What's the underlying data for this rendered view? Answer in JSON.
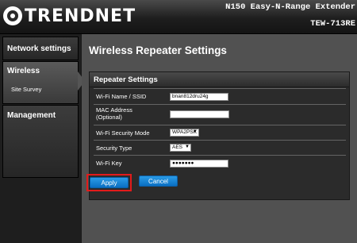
{
  "header": {
    "brand": "TRENDNET",
    "product_title": "N150 Easy-N-Range Extender",
    "model": "TEW-713RE"
  },
  "sidebar": {
    "items": [
      {
        "label": "Network settings"
      },
      {
        "label": "Wireless",
        "sub": "Site Survey"
      },
      {
        "label": "Management"
      }
    ]
  },
  "main": {
    "title": "Wireless Repeater Settings",
    "panel_title": "Repeater Settings",
    "fields": {
      "ssid_label": "Wi-Fi Name / SSID",
      "ssid_value": "bnan812dru24g",
      "mac_label_line1": "MAC Address",
      "mac_label_line2": "(Optional)",
      "mac_value": "",
      "security_mode_label": "Wi-Fi Security Mode",
      "security_mode_value": "WPA2PSK",
      "security_type_label": "Security Type",
      "security_type_value": "AES",
      "key_label": "Wi-Fi Key",
      "key_value": "●●●●●●●"
    },
    "buttons": {
      "apply": "Apply",
      "cancel": "Cancel"
    }
  }
}
